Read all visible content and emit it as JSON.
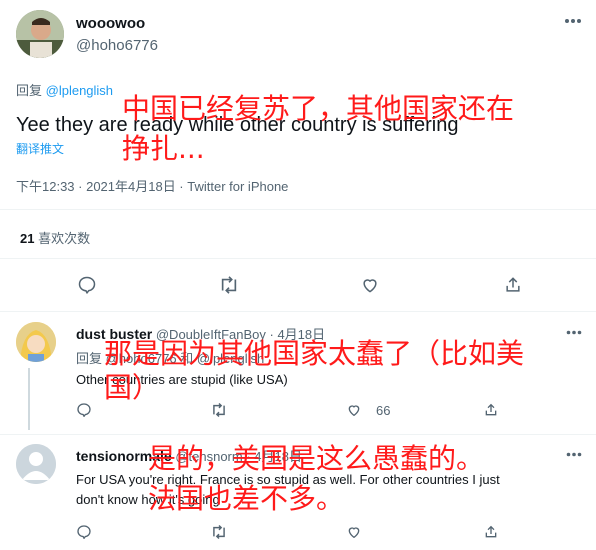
{
  "main_tweet": {
    "display_name": "wooowoo",
    "handle": "@hoho6776",
    "reply_prefix": "回复",
    "reply_to": "@lplenglish",
    "text": "Yee they are ready while other country is suffering",
    "translate": "翻译推文",
    "timestamp": "下午12:33 · 2021年4月18日 · Twitter for iPhone",
    "likes_count": "21",
    "likes_label": "喜欢次数",
    "annotation": [
      "中国已经复苏了，其他国家还在",
      "挣扎..."
    ]
  },
  "reply1": {
    "display_name": "dust buster",
    "handle": "@DoubleIftFanBoy",
    "date": "· 4月18日",
    "reply_line": "回复 @hoho6776 和 @lplenglish",
    "text": "Other countries are stupid (like USA)",
    "like_count": "66",
    "annotation": [
      "那是因为其他国家太蠢了（比如美",
      "国）"
    ]
  },
  "reply2": {
    "display_name": "tensionormale",
    "handle": "@tensnorm · 4月18日",
    "text_line1": "For USA you're right. France is so stupid as well. For other countries I just",
    "text_line2": "don't know how it's going",
    "annotation": [
      "是的，美国是这么愚蠢的。",
      "法国也差不多。"
    ]
  },
  "icons": [
    "more-icon",
    "reply-icon",
    "retweet-icon",
    "like-icon",
    "share-icon"
  ],
  "colors": {
    "accent": "#1d9bf0",
    "annotation": "#ff1a1a",
    "muted": "#536471"
  }
}
